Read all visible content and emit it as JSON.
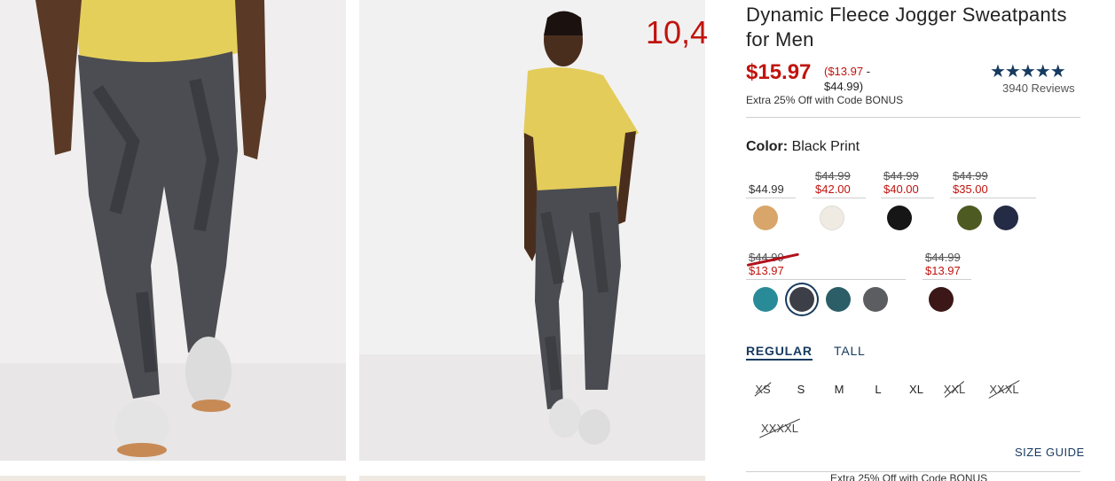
{
  "overlay_label": "10,4",
  "product": {
    "title": "Dynamic Fleece Jogger Sweatpants for Men",
    "price_now": "$15.97",
    "price_range_low": "($13.97",
    "price_range_dash": " -",
    "price_range_high": "$44.99)",
    "promo": "Extra 25% Off with Code BONUS",
    "stars": "★★★★★",
    "reviews": "3940 Reviews",
    "rating": 5
  },
  "color": {
    "label": "Color:",
    "value": "Black Print"
  },
  "price_groups": [
    {
      "plain": "$44.99"
    },
    {
      "was": "$44.99",
      "now": "$42.00"
    },
    {
      "was": "$44.99",
      "now": "$40.00"
    },
    {
      "was": "$44.99",
      "now": "$35.00"
    },
    {
      "was": "$44.99",
      "now": "$13.97"
    },
    {
      "was": "$44.99",
      "now": "$13.97"
    }
  ],
  "swatches": [
    {
      "name": "tan",
      "color": "#d8a56a"
    },
    {
      "name": "cream",
      "color": "#efebe3"
    },
    {
      "name": "black",
      "color": "#161616"
    },
    {
      "name": "olive-camo",
      "color": "#4d5a22"
    },
    {
      "name": "navy",
      "color": "#232b45"
    },
    {
      "name": "teal",
      "color": "#2a8b98"
    },
    {
      "name": "black-print",
      "color": "#3d3f48",
      "selected": true
    },
    {
      "name": "teal-print",
      "color": "#2b5e66"
    },
    {
      "name": "gray-print",
      "color": "#5b5d60"
    },
    {
      "name": "maroon",
      "color": "#3b1717"
    }
  ],
  "fit": {
    "active": "REGULAR",
    "inactive": "TALL"
  },
  "sizes": [
    {
      "label": "XS",
      "available": false
    },
    {
      "label": "S",
      "available": true
    },
    {
      "label": "M",
      "available": true
    },
    {
      "label": "L",
      "available": true
    },
    {
      "label": "XL",
      "available": true
    },
    {
      "label": "XXL",
      "available": false
    },
    {
      "label": "XXXL",
      "available": false
    },
    {
      "label": "XXXXL",
      "available": false
    }
  ],
  "size_guide": "SIZE GUIDE",
  "bottom_promo": "Extra 25% Off with Code BONUS",
  "colors": {
    "sale_red": "#c0140e",
    "navy": "#163a5f"
  }
}
